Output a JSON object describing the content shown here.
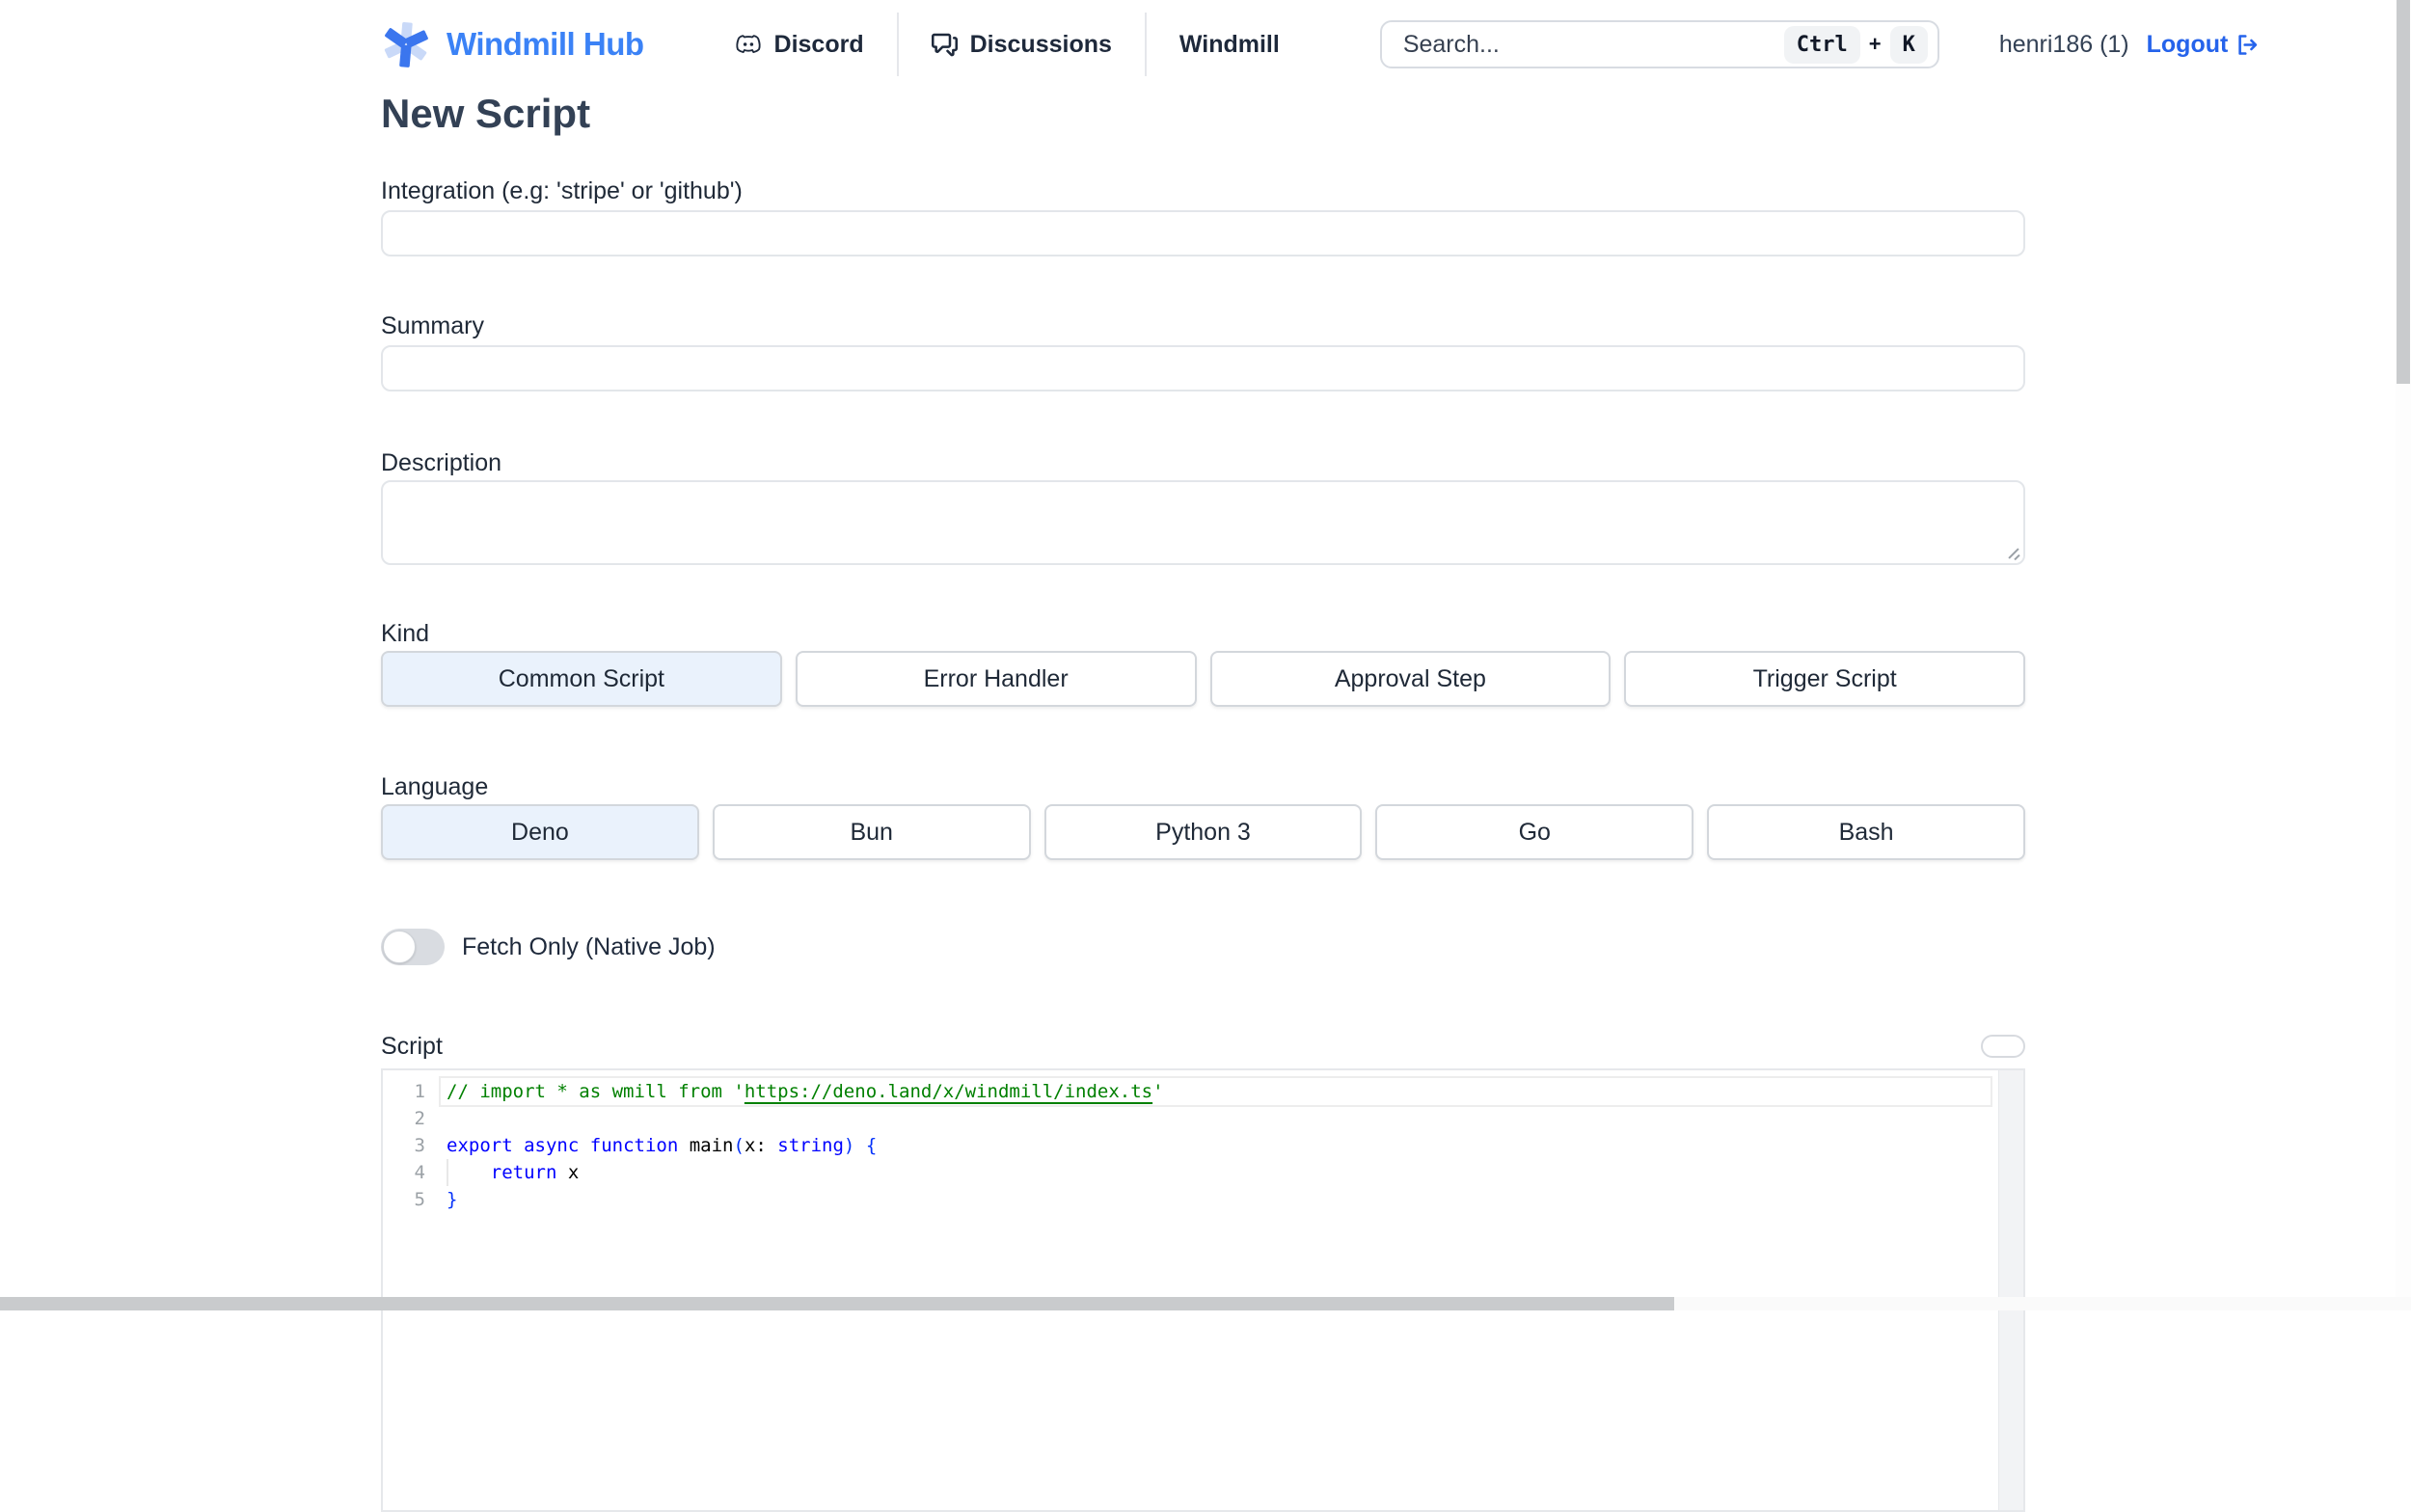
{
  "header": {
    "logo_text": "Windmill Hub",
    "nav": [
      {
        "label": "Discord",
        "icon": "discord-icon"
      },
      {
        "label": "Discussions",
        "icon": "github-discussions-icon"
      },
      {
        "label": "Windmill",
        "icon": null
      }
    ],
    "search": {
      "placeholder": "Search...",
      "kbd_ctrl": "Ctrl",
      "kbd_plus": "+",
      "kbd_k": "K"
    },
    "user": {
      "name": "henri186 (1)",
      "logout_label": "Logout"
    }
  },
  "page": {
    "title": "New Script"
  },
  "form": {
    "integration": {
      "label": "Integration (e.g: 'stripe' or 'github')",
      "value": ""
    },
    "summary": {
      "label": "Summary",
      "value": ""
    },
    "description": {
      "label": "Description",
      "value": ""
    },
    "kind": {
      "label": "Kind",
      "selected": "Common Script",
      "options": [
        "Common Script",
        "Error Handler",
        "Approval Step",
        "Trigger Script"
      ]
    },
    "language": {
      "label": "Language",
      "selected": "Deno",
      "options": [
        "Deno",
        "Bun",
        "Python 3",
        "Go",
        "Bash"
      ]
    },
    "fetch_only": {
      "label": "Fetch Only (Native Job)",
      "enabled": false
    },
    "script": {
      "label": "Script"
    }
  },
  "editor": {
    "lines": [
      {
        "number": "1",
        "current": true,
        "tokens": [
          {
            "text": "// import * as wmill from '",
            "style": "comment"
          },
          {
            "text": "https://deno.land/x/windmill/index.ts",
            "style": "comment-link"
          },
          {
            "text": "'",
            "style": "comment"
          }
        ]
      },
      {
        "number": "2",
        "tokens": []
      },
      {
        "number": "3",
        "tokens": [
          {
            "text": "export",
            "style": "keyword"
          },
          {
            "text": " ",
            "style": "plain"
          },
          {
            "text": "async",
            "style": "keyword"
          },
          {
            "text": " ",
            "style": "plain"
          },
          {
            "text": "function",
            "style": "keyword"
          },
          {
            "text": " ",
            "style": "plain"
          },
          {
            "text": "main",
            "style": "plain"
          },
          {
            "text": "(",
            "style": "bracket"
          },
          {
            "text": "x",
            "style": "plain"
          },
          {
            "text": ": ",
            "style": "plain"
          },
          {
            "text": "string",
            "style": "keyword"
          },
          {
            "text": ")",
            "style": "bracket"
          },
          {
            "text": " ",
            "style": "plain"
          },
          {
            "text": "{",
            "style": "bracket"
          }
        ]
      },
      {
        "number": "4",
        "indent_guide": true,
        "tokens": [
          {
            "text": "    ",
            "style": "plain"
          },
          {
            "text": "return",
            "style": "keyword"
          },
          {
            "text": " x",
            "style": "plain"
          }
        ]
      },
      {
        "number": "5",
        "tokens": [
          {
            "text": "}",
            "style": "bracket"
          }
        ]
      }
    ]
  },
  "colors": {
    "accent": "#2563eb",
    "logo_blue": "#3b82f6",
    "logo_light_blue": "#c9d9f8",
    "selected_option_bg": "#eaf2fc",
    "code_comment": "#008000",
    "code_keyword": "#0000ff",
    "code_bracket": "#0431fa",
    "code_plain": "#000000",
    "line_number": "#9ba1a6",
    "scrollbar_thumb": "#c9cbcd"
  }
}
